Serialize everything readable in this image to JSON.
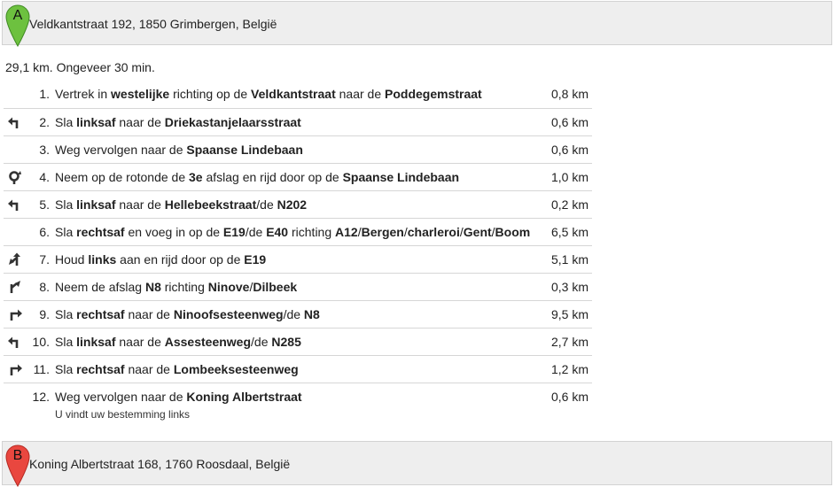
{
  "start": {
    "letter": "A",
    "address": "Veldkantstraat 192, 1850 Grimbergen, België",
    "color": "#6dc13f"
  },
  "end": {
    "letter": "B",
    "address": "Koning Albertstraat 168, 1760 Roosdaal, België",
    "color": "#e9473f"
  },
  "summary": "29,1 km. Ongeveer 30 min.",
  "steps": [
    {
      "num": "1.",
      "icon": "none",
      "dist": "0,8 km",
      "parts": [
        [
          "Vertrek in ",
          false
        ],
        [
          "westelijke",
          true
        ],
        [
          " richting op de ",
          false
        ],
        [
          "Veldkantstraat",
          true
        ],
        [
          " naar de ",
          false
        ],
        [
          "Poddegemstraat",
          true
        ]
      ]
    },
    {
      "num": "2.",
      "icon": "turn-left-icon",
      "dist": "0,6 km",
      "parts": [
        [
          "Sla ",
          false
        ],
        [
          "linksaf",
          true
        ],
        [
          " naar de ",
          false
        ],
        [
          "Driekastanjelaarsstraat",
          true
        ]
      ]
    },
    {
      "num": "3.",
      "icon": "none",
      "dist": "0,6 km",
      "parts": [
        [
          "Weg vervolgen naar de ",
          false
        ],
        [
          "Spaanse Lindebaan",
          true
        ]
      ]
    },
    {
      "num": "4.",
      "icon": "roundabout-icon",
      "dist": "1,0 km",
      "parts": [
        [
          "Neem op de rotonde de ",
          false
        ],
        [
          "3e",
          true
        ],
        [
          " afslag en rijd door op de ",
          false
        ],
        [
          "Spaanse Lindebaan",
          true
        ]
      ]
    },
    {
      "num": "5.",
      "icon": "turn-left-icon",
      "dist": "0,2 km",
      "parts": [
        [
          "Sla ",
          false
        ],
        [
          "linksaf",
          true
        ],
        [
          " naar de ",
          false
        ],
        [
          "Hellebeekstraat",
          true
        ],
        [
          "/de ",
          false
        ],
        [
          "N202",
          true
        ]
      ]
    },
    {
      "num": "6.",
      "icon": "none",
      "dist": "6,5 km",
      "parts": [
        [
          "Sla ",
          false
        ],
        [
          "rechtsaf",
          true
        ],
        [
          " en voeg in op de ",
          false
        ],
        [
          "E19",
          true
        ],
        [
          "/de ",
          false
        ],
        [
          "E40",
          true
        ],
        [
          " richting ",
          false
        ],
        [
          "A12",
          true
        ],
        [
          "/",
          false
        ],
        [
          "Bergen",
          true
        ],
        [
          "/",
          false
        ],
        [
          "charleroi",
          true
        ],
        [
          "/",
          false
        ],
        [
          "Gent",
          true
        ],
        [
          "/",
          false
        ],
        [
          "Boom",
          true
        ]
      ]
    },
    {
      "num": "7.",
      "icon": "keep-left-icon",
      "dist": "5,1 km",
      "parts": [
        [
          "Houd ",
          false
        ],
        [
          "links",
          true
        ],
        [
          " aan en rijd door op de ",
          false
        ],
        [
          "E19",
          true
        ]
      ]
    },
    {
      "num": "8.",
      "icon": "ramp-right-icon",
      "dist": "0,3 km",
      "parts": [
        [
          "Neem de afslag ",
          false
        ],
        [
          "N8",
          true
        ],
        [
          " richting ",
          false
        ],
        [
          "Ninove",
          true
        ],
        [
          "/",
          false
        ],
        [
          "Dilbeek",
          true
        ]
      ]
    },
    {
      "num": "9.",
      "icon": "turn-right-icon",
      "dist": "9,5 km",
      "parts": [
        [
          "Sla ",
          false
        ],
        [
          "rechtsaf",
          true
        ],
        [
          " naar de ",
          false
        ],
        [
          "Ninoofsesteenweg",
          true
        ],
        [
          "/de ",
          false
        ],
        [
          "N8",
          true
        ]
      ]
    },
    {
      "num": "10.",
      "icon": "turn-left-icon",
      "dist": "2,7 km",
      "parts": [
        [
          "Sla ",
          false
        ],
        [
          "linksaf",
          true
        ],
        [
          " naar de ",
          false
        ],
        [
          "Assesteenweg",
          true
        ],
        [
          "/de ",
          false
        ],
        [
          "N285",
          true
        ]
      ]
    },
    {
      "num": "11.",
      "icon": "turn-right-icon",
      "dist": "1,2 km",
      "parts": [
        [
          "Sla ",
          false
        ],
        [
          "rechtsaf",
          true
        ],
        [
          " naar de ",
          false
        ],
        [
          "Lombeeksesteenweg",
          true
        ]
      ]
    },
    {
      "num": "12.",
      "icon": "none",
      "dist": "0,6 km",
      "parts": [
        [
          "Weg vervolgen naar de ",
          false
        ],
        [
          "Koning Albertstraat",
          true
        ]
      ],
      "sub": "U vindt uw bestemming links"
    }
  ]
}
